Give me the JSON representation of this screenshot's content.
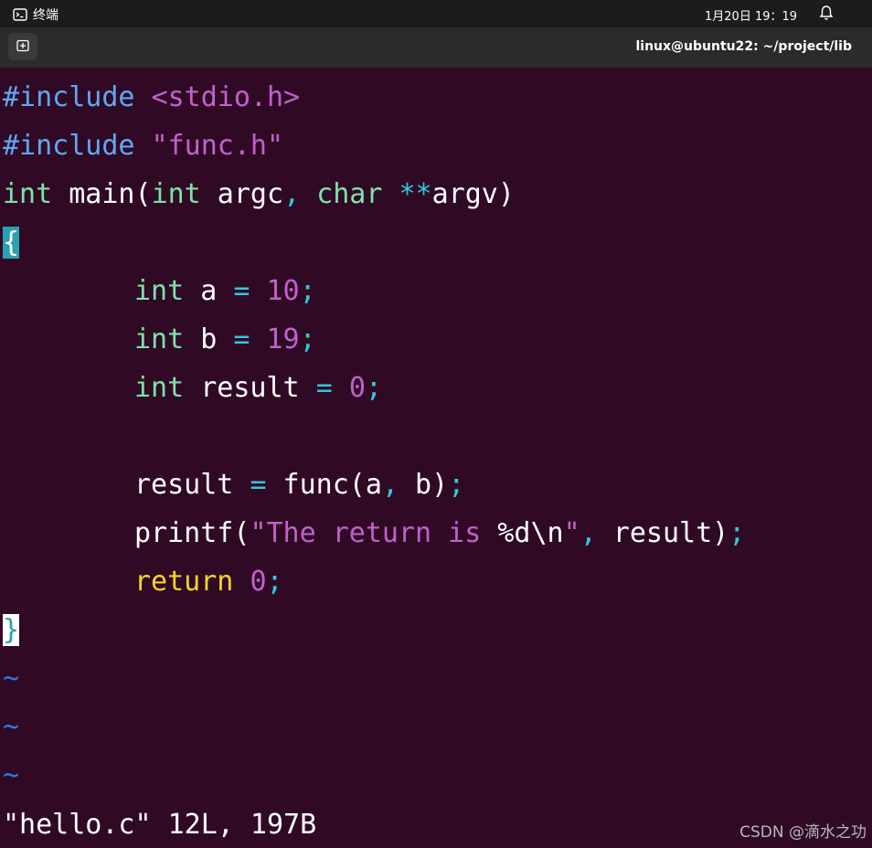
{
  "topbar": {
    "app_name": "终端",
    "date": "1月20日",
    "time": "19：19"
  },
  "window": {
    "title": "linux@ubuntu22: ~/project/lib"
  },
  "code": {
    "line1": {
      "a": "#include ",
      "b": "<stdio.h>"
    },
    "line2": {
      "a": "#include ",
      "b": "\"func.h\""
    },
    "line3": {
      "a": "int",
      "b": " main(",
      "c": "int",
      "d": " argc",
      "e": ",",
      "f": " ",
      "g": "char",
      "h": " ",
      "i": "**",
      "j": "argv)"
    },
    "line4": {
      "a": "{"
    },
    "line5": {
      "a": "int",
      "b": " a ",
      "c": "=",
      "d": " ",
      "e": "10",
      "f": ";"
    },
    "line6": {
      "a": "int",
      "b": " b ",
      "c": "=",
      "d": " ",
      "e": "19",
      "f": ";"
    },
    "line7": {
      "a": "int",
      "b": " result ",
      "c": "=",
      "d": " ",
      "e": "0",
      "f": ";"
    },
    "line9": {
      "a": "result ",
      "b": "=",
      "c": " func(a",
      "d": ",",
      "e": " b)",
      "f": ";"
    },
    "line10": {
      "a": "printf(",
      "b": "\"The return is ",
      "c": "%d\\n",
      "d": "\"",
      "e": ",",
      "f": " result)",
      "g": ";"
    },
    "line11": {
      "a": "return",
      "b": " ",
      "c": "0",
      "d": ";"
    },
    "line12": {
      "a": "}"
    },
    "tilde": "~"
  },
  "status_line": "\"hello.c\" 12L, 197B",
  "watermark": "CSDN @滴水之功",
  "colors": {
    "background": "#300a24",
    "preprocessor": "#5fa8f5",
    "string": "#c061cb",
    "type": "#7ee2a8",
    "operator": "#33c7de",
    "keyword": "#f6d32d",
    "tilde": "#2a7bde"
  },
  "icons": {
    "app": "terminal-icon",
    "bell": "bell-icon",
    "new_tab": "new-tab-icon"
  }
}
